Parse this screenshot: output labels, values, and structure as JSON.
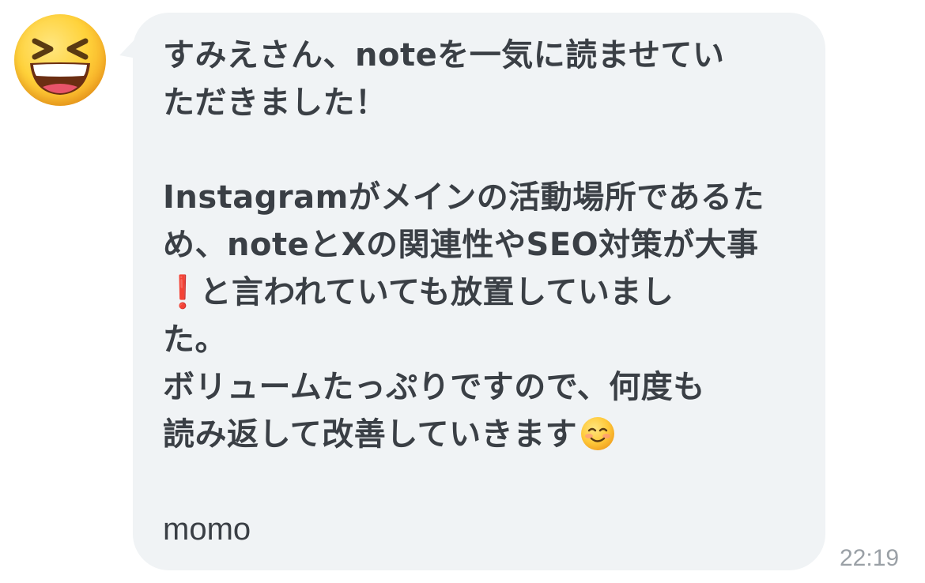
{
  "avatar": {
    "icon": "grinning-squinting-face-icon"
  },
  "message": {
    "line1": "すみえさん、noteを一気に読ませてい",
    "line2": "ただきました！",
    "line3": "Instagramがメインの活動場所であるた",
    "line4": "め、noteとXの関連性やSEO対策が大事",
    "line5_exclaim": "❗",
    "line5": "と言われていても放置していまし",
    "line6": "た。",
    "line7": "ボリュームたっぷりですので、何度も",
    "line8": "読み返して改善していきます",
    "line8_emoji": "smiling-face-icon",
    "signature": "momo"
  },
  "timestamp": "22:19",
  "colors": {
    "bubble": "#f0f3f5",
    "text": "#3a3f45",
    "timestamp": "#9aa0a6",
    "exclamation": "#e0131f"
  }
}
